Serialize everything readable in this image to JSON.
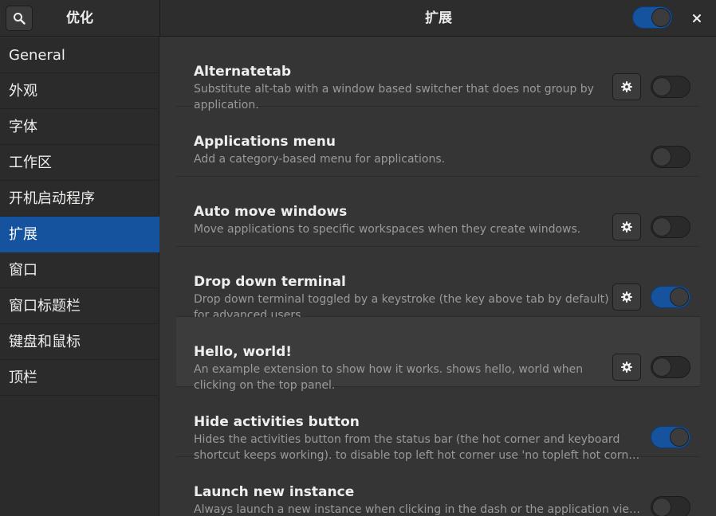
{
  "header": {
    "app_title": "优化",
    "main_title": "扩展",
    "master_enabled": true,
    "icons": {
      "search": "search-icon",
      "close": "close-icon"
    }
  },
  "sidebar": {
    "items": [
      {
        "label": "General",
        "active": false
      },
      {
        "label": "外观",
        "active": false
      },
      {
        "label": "字体",
        "active": false
      },
      {
        "label": "工作区",
        "active": false
      },
      {
        "label": "开机启动程序",
        "active": false
      },
      {
        "label": "扩展",
        "active": true
      },
      {
        "label": "窗口",
        "active": false
      },
      {
        "label": "窗口标题栏",
        "active": false
      },
      {
        "label": "键盘和鼠标",
        "active": false
      },
      {
        "label": "顶栏",
        "active": false
      }
    ]
  },
  "extensions": [
    {
      "title": "Alternatetab",
      "desc1": "Substitute alt-tab with a window based switcher that does not group by",
      "desc2": "application.",
      "has_settings": true,
      "enabled": false
    },
    {
      "title": "Applications menu",
      "desc1": "Add a category-based menu for applications.",
      "desc2": "",
      "has_settings": false,
      "enabled": false
    },
    {
      "title": "Auto move windows",
      "desc1": "Move applications to specific workspaces when they create windows.",
      "desc2": "",
      "has_settings": true,
      "enabled": false
    },
    {
      "title": "Drop down terminal",
      "desc1": "Drop down terminal toggled by a keystroke (the key above tab by default)",
      "desc2": "for advanced users.",
      "has_settings": true,
      "enabled": true
    },
    {
      "title": "Hello, world!",
      "desc1": "An example extension to show how it works. shows hello, world when",
      "desc2": "clicking on the top panel.",
      "has_settings": true,
      "enabled": false
    },
    {
      "title": "Hide activities button",
      "desc1": "Hides the activities button from the status bar (the hot corner and keyboard",
      "desc2": "shortcut keeps working). to disable top left hot corner use 'no topleft hot corne…",
      "has_settings": false,
      "enabled": true
    },
    {
      "title": "Launch new instance",
      "desc1": "Always launch a new instance when clicking in the dash or the application view.",
      "desc2": "",
      "has_settings": false,
      "enabled": false
    }
  ],
  "colors": {
    "accent": "#15539e",
    "bg": "#353535",
    "sidebar": "#2b2b2b"
  }
}
